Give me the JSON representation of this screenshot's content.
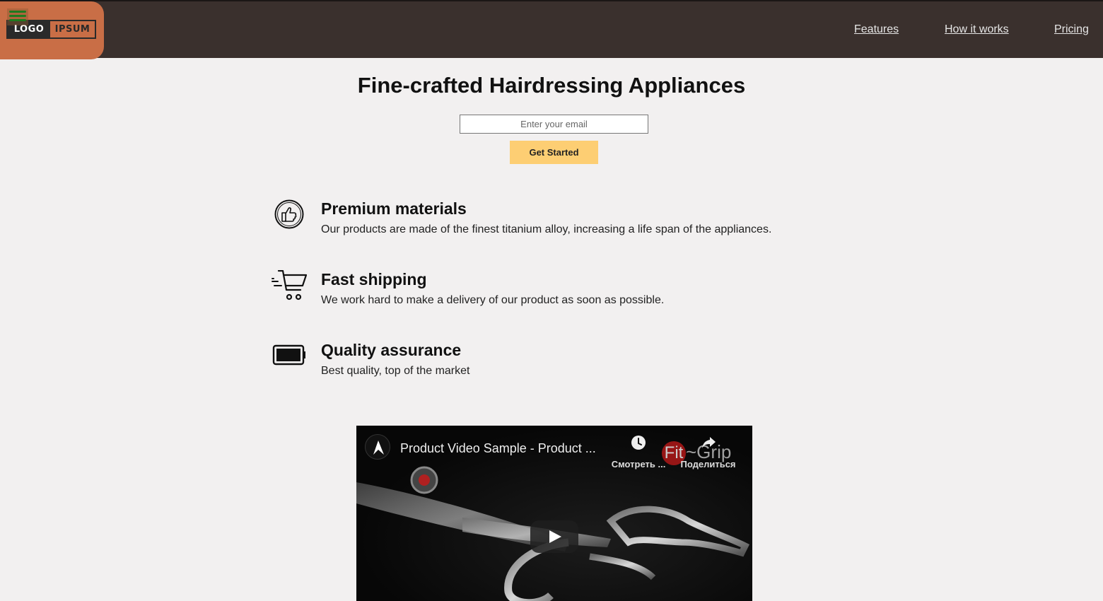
{
  "header": {
    "logo_left": "LOGO",
    "logo_right": "IPSUM",
    "nav": [
      {
        "label": "Features"
      },
      {
        "label": "How it works"
      },
      {
        "label": "Pricing"
      }
    ]
  },
  "hero": {
    "title": "Fine-crafted Hairdressing Appliances",
    "email_placeholder": "Enter your email",
    "cta_label": "Get Started"
  },
  "features": [
    {
      "icon": "thumbs-up-icon",
      "title": "Premium materials",
      "text": "Our products are made of the finest titanium alloy, increasing a life span of the appliances."
    },
    {
      "icon": "shopping-cart-icon",
      "title": "Fast shipping",
      "text": "We work hard to make a delivery of our product as soon as possible."
    },
    {
      "icon": "battery-icon",
      "title": "Quality assurance",
      "text": "Best quality, top of the market"
    }
  ],
  "video": {
    "title": "Product Video Sample - Product ...",
    "watch_later_label": "Смотреть ...",
    "share_label": "Поделиться",
    "brand_mark": "Fit",
    "brand_text": "~Grip"
  }
}
